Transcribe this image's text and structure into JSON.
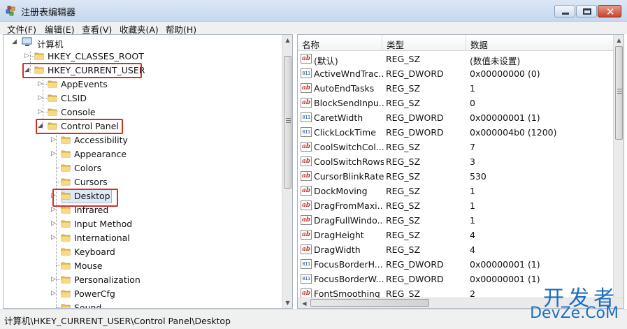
{
  "window": {
    "title": "注册表编辑器"
  },
  "menu": [
    "文件(F)",
    "编辑(E)",
    "查看(V)",
    "收藏夹(A)",
    "帮助(H)"
  ],
  "tree": {
    "root": "计算机",
    "nodes": [
      {
        "label": "HKEY_CLASSES_ROOT",
        "expander": "▷"
      },
      {
        "label": "HKEY_CURRENT_USER",
        "expander": "◢"
      },
      {
        "label": "AppEvents",
        "expander": "▷"
      },
      {
        "label": "CLSID",
        "expander": "▷"
      },
      {
        "label": "Console",
        "expander": "▷"
      },
      {
        "label": "Control Panel",
        "expander": "◢"
      },
      {
        "label": "Accessibility",
        "expander": "▷"
      },
      {
        "label": "Appearance",
        "expander": "▷"
      },
      {
        "label": "Colors",
        "expander": ""
      },
      {
        "label": "Cursors",
        "expander": ""
      },
      {
        "label": "Desktop",
        "expander": "▷"
      },
      {
        "label": "Infrared",
        "expander": "▷"
      },
      {
        "label": "Input Method",
        "expander": "▷"
      },
      {
        "label": "International",
        "expander": "▷"
      },
      {
        "label": "Keyboard",
        "expander": ""
      },
      {
        "label": "Mouse",
        "expander": ""
      },
      {
        "label": "Personalization",
        "expander": "▷"
      },
      {
        "label": "PowerCfg",
        "expander": "▷"
      },
      {
        "label": "Sound",
        "expander": ""
      }
    ]
  },
  "columns": {
    "name": "名称",
    "type": "类型",
    "data": "数据"
  },
  "values": [
    {
      "icon": "string-value-icon",
      "name": "(默认)",
      "type": "REG_SZ",
      "data": "(数值未设置)"
    },
    {
      "icon": "dword-value-icon",
      "name": "ActiveWndTrac...",
      "type": "REG_DWORD",
      "data": "0x00000000 (0)"
    },
    {
      "icon": "string-value-icon",
      "name": "AutoEndTasks",
      "type": "REG_SZ",
      "data": "1"
    },
    {
      "icon": "string-value-icon",
      "name": "BlockSendInpu...",
      "type": "REG_SZ",
      "data": "0"
    },
    {
      "icon": "dword-value-icon",
      "name": "CaretWidth",
      "type": "REG_DWORD",
      "data": "0x00000001 (1)"
    },
    {
      "icon": "dword-value-icon",
      "name": "ClickLockTime",
      "type": "REG_DWORD",
      "data": "0x000004b0 (1200)"
    },
    {
      "icon": "string-value-icon",
      "name": "CoolSwitchCol...",
      "type": "REG_SZ",
      "data": "7"
    },
    {
      "icon": "string-value-icon",
      "name": "CoolSwitchRows",
      "type": "REG_SZ",
      "data": "3"
    },
    {
      "icon": "string-value-icon",
      "name": "CursorBlinkRate",
      "type": "REG_SZ",
      "data": "530"
    },
    {
      "icon": "string-value-icon",
      "name": "DockMoving",
      "type": "REG_SZ",
      "data": "1"
    },
    {
      "icon": "string-value-icon",
      "name": "DragFromMaxi...",
      "type": "REG_SZ",
      "data": "1"
    },
    {
      "icon": "string-value-icon",
      "name": "DragFullWindo...",
      "type": "REG_SZ",
      "data": "1"
    },
    {
      "icon": "string-value-icon",
      "name": "DragHeight",
      "type": "REG_SZ",
      "data": "4"
    },
    {
      "icon": "string-value-icon",
      "name": "DragWidth",
      "type": "REG_SZ",
      "data": "4"
    },
    {
      "icon": "dword-value-icon",
      "name": "FocusBorderH...",
      "type": "REG_DWORD",
      "data": "0x00000001 (1)"
    },
    {
      "icon": "dword-value-icon",
      "name": "FocusBorderW...",
      "type": "REG_DWORD",
      "data": "0x00000001 (1)"
    },
    {
      "icon": "string-value-icon",
      "name": "FontSmoothing",
      "type": "REG_SZ",
      "data": "2"
    }
  ],
  "status": "计算机\\HKEY_CURRENT_USER\\Control Panel\\Desktop",
  "watermark": {
    "top": "开发者",
    "bottom": "DevZe.CoM"
  },
  "colors": {
    "highlight_box": "#d0302a",
    "watermark": "#1a6fc2"
  }
}
